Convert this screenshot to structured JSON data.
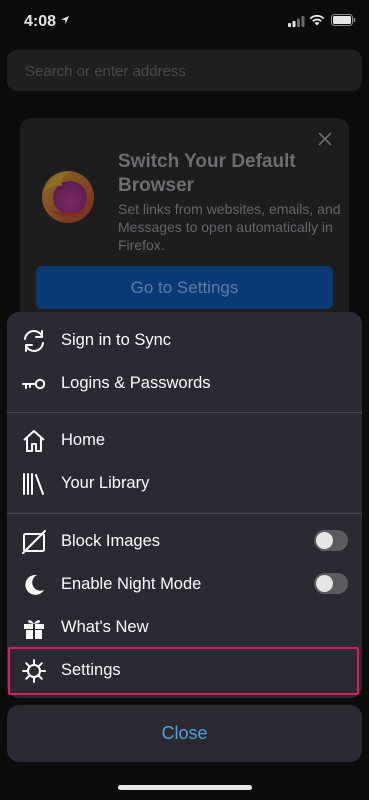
{
  "status_bar": {
    "time": "4:08"
  },
  "address_bar": {
    "placeholder": "Search or enter address"
  },
  "promo": {
    "title": "Switch Your Default Browser",
    "description": "Set links from websites, emails, and Messages to open automatically in Firefox.",
    "button_label": "Go to Settings"
  },
  "menu": {
    "sign_in": "Sign in to Sync",
    "logins": "Logins & Passwords",
    "home": "Home",
    "library": "Your Library",
    "block_images": "Block Images",
    "night_mode": "Enable Night Mode",
    "whats_new": "What's New",
    "settings": "Settings"
  },
  "toggles": {
    "block_images_on": false,
    "night_mode_on": false
  },
  "close_label": "Close",
  "colors": {
    "highlight": "#d61f5e",
    "accent": "#4fa3e3",
    "promo_button": "#0a3a73"
  },
  "icons": {
    "sign_in": "sync-icon",
    "logins": "key-icon",
    "home": "home-icon",
    "library": "library-icon",
    "block_images": "block-images-icon",
    "night_mode": "moon-icon",
    "whats_new": "gift-icon",
    "settings": "gear-icon"
  }
}
